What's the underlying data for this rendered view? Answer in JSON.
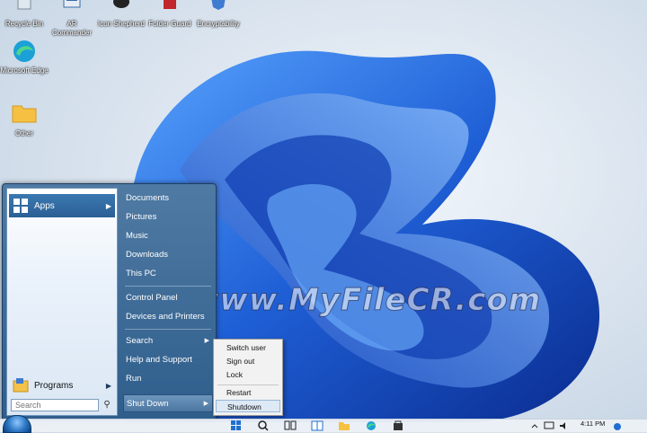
{
  "desktop": {
    "icons": [
      {
        "name": "recycle-bin",
        "label": "Recycle Bin"
      },
      {
        "name": "ar-commander",
        "label": "AR Commander"
      },
      {
        "name": "icon-shepherd",
        "label": "Icon Shepherd"
      },
      {
        "name": "folder-guard",
        "label": "Folder Guard"
      },
      {
        "name": "encryptability",
        "label": "Encryptability"
      },
      {
        "name": "microsoft-edge",
        "label": "Microsoft Edge"
      },
      {
        "name": "other-folder",
        "label": "Other"
      }
    ]
  },
  "start_menu": {
    "left": {
      "apps_label": "Apps",
      "programs_label": "Programs",
      "search_placeholder": "Search"
    },
    "right": {
      "items": [
        "Documents",
        "Pictures",
        "Music",
        "Downloads",
        "This PC",
        "Control Panel",
        "Devices and Printers",
        "Search",
        "Help and Support",
        "Run",
        "Shut Down"
      ]
    },
    "shutdown_submenu": [
      "Switch user",
      "Sign out",
      "Lock",
      "Restart",
      "Shutdown"
    ]
  },
  "watermark": "www.MyFileCR.com",
  "taskbar": {
    "time": "4:11 PM"
  },
  "colors": {
    "accent": "#1f5fd6",
    "menu_blue": "#2f5e8c"
  }
}
